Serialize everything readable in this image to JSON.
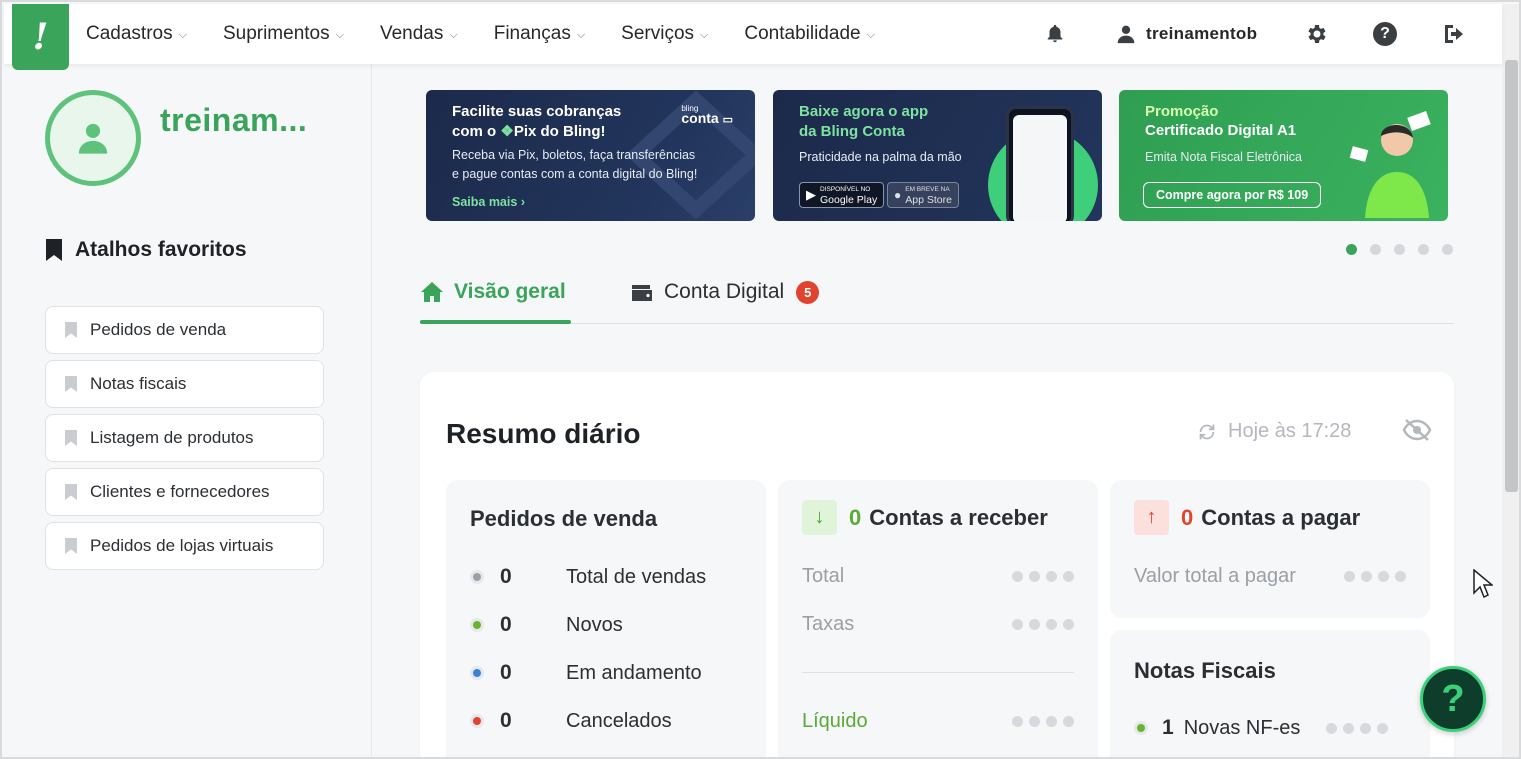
{
  "topbar": {
    "logo_text": "!",
    "nav": [
      "Cadastros",
      "Suprimentos",
      "Vendas",
      "Finanças",
      "Serviços",
      "Contabilidade"
    ],
    "user_name": "treinamentob",
    "help_glyph": "?"
  },
  "sidebar": {
    "profile_name": "treinam...",
    "favorites_title": "Atalhos favoritos",
    "favorites": [
      "Pedidos de venda",
      "Notas fiscais",
      "Listagem de produtos",
      "Clientes e fornecedores",
      "Pedidos de lojas virtuais"
    ]
  },
  "banners": {
    "b1": {
      "title_a": "Facilite suas cobranças",
      "title_b": "com o",
      "title_hl": "Pix do Bling!",
      "brand_small": "bling",
      "brand": "conta",
      "sub1": "Receba via Pix, boletos, faça transferências",
      "sub2": "e pague contas com a conta digital do Bling!",
      "link": "Saiba mais"
    },
    "b2": {
      "title1": "Baixe agora o app",
      "title2": "da Bling Conta",
      "sub": "Praticidade na palma da mão",
      "gp_small": "DISPONÍVEL NO",
      "gp": "Google Play",
      "as_small": "EM BREVE NA",
      "as": "App Store"
    },
    "b3": {
      "title1": "Promoção",
      "title2": "Certificado Digital A1",
      "sub": "Emita Nota Fiscal Eletrônica",
      "cta_a": "Compre agora",
      "cta_b": "por R$ 109"
    }
  },
  "carousel": {
    "count": 5,
    "active": 1
  },
  "tabs": {
    "overview": "Visão geral",
    "digital": "Conta Digital",
    "digital_badge": "5"
  },
  "summary": {
    "title": "Resumo diário",
    "refresh": "Hoje às 17:28",
    "orders": {
      "title": "Pedidos de venda",
      "rows": [
        {
          "value": "0",
          "label": "Total de vendas",
          "color": "#9aa0a6"
        },
        {
          "value": "0",
          "label": "Novos",
          "color": "#6ab42f"
        },
        {
          "value": "0",
          "label": "Em andamento",
          "color": "#3b82d6"
        },
        {
          "value": "0",
          "label": "Cancelados",
          "color": "#e0442f"
        }
      ]
    },
    "receivable": {
      "arrow": "↓",
      "count": "0",
      "title": "Contas a receber",
      "total": "Total",
      "fees": "Taxas",
      "net": "Líquido"
    },
    "payable": {
      "arrow": "↑",
      "count": "0",
      "title": "Contas a pagar",
      "total": "Valor total a pagar"
    },
    "invoices": {
      "title": "Notas Fiscais",
      "count": "1",
      "label": "Novas NF-es"
    }
  },
  "fab": {
    "label": "?"
  }
}
